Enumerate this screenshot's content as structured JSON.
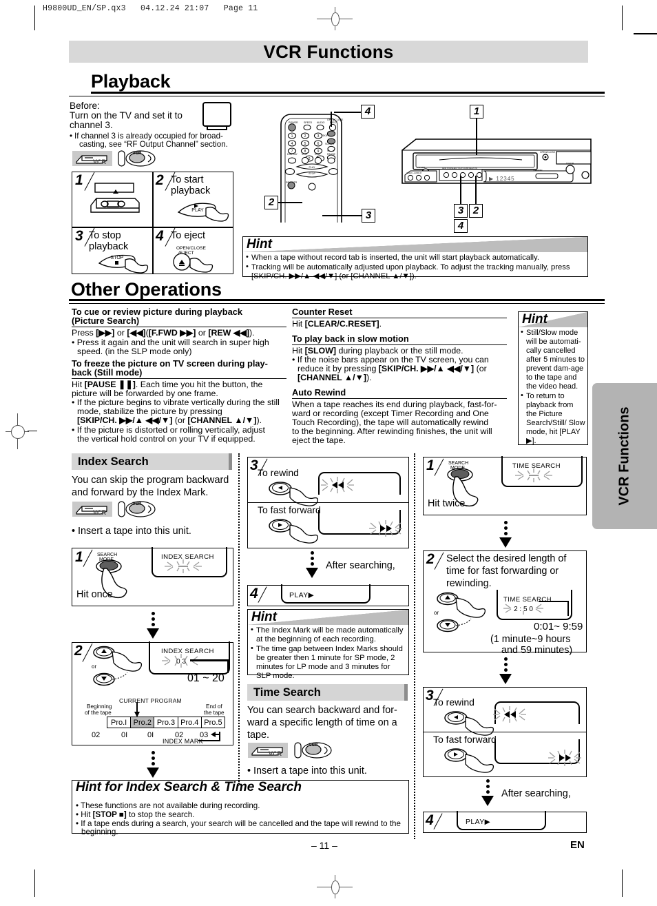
{
  "printer_slug": "H9800UD_EN/SP.qx3   04.12.24 21:07   Page 11",
  "banner_title": "VCR Functions",
  "page_number": "– 11 –",
  "language_code": "EN",
  "side_tab": "VCR Functions",
  "playback": {
    "heading": "Playback",
    "before_label": "Before:",
    "before_line1": "Turn on the TV and set it to",
    "before_line2": "channel 3.",
    "before_note_1": "If channel 3 is already occupied for broad-",
    "before_note_2": "casting, see “RF Output Channel” section.",
    "device_badges": [
      "VCR-tape-icon",
      "vcr-remote-icon"
    ],
    "steps": [
      {
        "num": "1",
        "label": "",
        "icon": "insert-tape-icon"
      },
      {
        "num": "2",
        "label_line1": "To start",
        "label_line2": "playback",
        "button": "PLAY",
        "icon": "play-button-hand-icon"
      },
      {
        "num": "3",
        "label_line1": "To stop",
        "label_line2": "playback",
        "button": "STOP",
        "icon": "stop-button-hand-icon"
      },
      {
        "num": "4",
        "label_line1": "To eject",
        "label_line2": "",
        "button_line1": "OPEN/CLOSE",
        "button_line2": "/EJECT",
        "icon": "eject-button-hand-icon"
      }
    ],
    "remote_callouts": [
      "4",
      "2",
      "3"
    ],
    "vcr_callouts": [
      "1",
      "3",
      "2",
      "4"
    ],
    "vcr_display_text": "12345",
    "remote_labels": [
      "POWER",
      "SPEED",
      "AUDIO",
      "OPEN/CLOSE",
      "EJECT",
      "SKIP/CH.",
      "SCR/TR",
      "SLOW",
      "DISPLAY",
      "VCR",
      "DVD",
      "PAUSE",
      "PLAY",
      "STOP",
      "REC/OTR"
    ],
    "hint": {
      "title": "Hint",
      "bullets": [
        "When a tape without record tab is inserted, the unit will start playback automatically.",
        "Tracking will be automatically adjusted upon playback. To adjust the tracking manually, press [SKIP/CH. ▶▶/▲ ◀◀/▼] (or [CHANNEL ▲/▼])."
      ]
    }
  },
  "other_operations": {
    "heading": "Other Operations",
    "left_column": [
      {
        "type": "h",
        "text": "To cue or review picture during playback (Picture Search)"
      },
      {
        "type": "p",
        "text": "Press [▶▶] or [◀◀]([F.FWD ▶▶] or [REW ◀◀])."
      },
      {
        "type": "b",
        "text": "Press it again and the unit will search in super high speed. (in the SLP mode only)"
      },
      {
        "type": "h",
        "text": "To freeze the picture on TV screen during play-back (Still mode)"
      },
      {
        "type": "p",
        "text": "Hit [PAUSE ❘❘]. Each time you hit the button, the picture will be forwarded by one frame."
      },
      {
        "type": "b",
        "text": "If the picture begins to vibrate vertically during the still mode, stabilize the picture by pressing [SKIP/CH. ▶▶/▲ ◀◀/▼] (or [CHANNEL ▲/▼])."
      },
      {
        "type": "b",
        "text": "If the picture is distorted or rolling vertically, adjust the vertical hold control on your TV if equipped."
      }
    ],
    "middle_column": [
      {
        "type": "h",
        "text": "Counter Reset"
      },
      {
        "type": "p",
        "text": "Hit [CLEAR/C.RESET]."
      },
      {
        "type": "h",
        "text": "To play back in slow motion"
      },
      {
        "type": "p",
        "text": "Hit [SLOW] during playback or the still mode."
      },
      {
        "type": "b",
        "text": "If the noise bars appear on the TV screen, you can reduce it by pressing [SKIP/CH. ▶▶/▲ ◀◀/▼] (or [CHANNEL ▲/▼])."
      },
      {
        "type": "h",
        "text": "Auto Rewind"
      },
      {
        "type": "p",
        "text": "When a tape reaches its end during playback, fast-forward or recording (except Timer Recording and One Touch Recording), the tape will automatically rewind to the beginning. After rewinding finishes, the unit will eject the tape."
      }
    ],
    "hint": {
      "title": "Hint",
      "bullets": [
        "Still/Slow mode will be automati-cally cancelled after 5 minutes to prevent dam-age to the tape and the video head.",
        "To return to playback from the Picture Search/Still/ Slow mode, hit [PLAY ▶]."
      ]
    }
  },
  "index_search": {
    "title": "Index Search",
    "intro_line1": "You can skip the program backward",
    "intro_line2": "and forward by the Index Mark.",
    "insert_note": "Insert a tape into this unit.",
    "step1": {
      "num": "1",
      "button_line1": "SEARCH",
      "button_line2": "MODE",
      "osd": "INDEX SEARCH",
      "caption": "Hit once."
    },
    "step2": {
      "num": "2",
      "or": "or",
      "osd": "INDEX SEARCH",
      "osd_value": "0 3",
      "range": "01 ~ 20",
      "current_program": "CURRENT PROGRAM",
      "beginning_line1": "Beginning",
      "beginning_line2": "of the tape",
      "end_line1": "End of",
      "end_line2": "the tape",
      "programs": [
        "Pro.I",
        "Pro.2",
        "Pro.3",
        "Pro.4",
        "Pro.5"
      ],
      "active_program_index": 1,
      "marks": [
        "02",
        "0I",
        "0I",
        "02",
        "03"
      ],
      "index_mark_label": "INDEX MARK"
    },
    "step3": {
      "num": "3",
      "rewind_label": "To rewind",
      "ff_label": "To fast forward",
      "rew_glyph": "◀◀",
      "ff_glyph": "▶▶"
    },
    "after_searching": "After searching,",
    "step4": {
      "num": "4",
      "osd": "PLAY▶"
    },
    "hint": {
      "title": "Hint",
      "bullets": [
        "The Index Mark will be made automatically at the beginning of each recording.",
        "The time gap between Index Marks should be greater then 1 minute for SP mode, 2 minutes for LP mode and 3 minutes for SLP mode."
      ]
    }
  },
  "time_search": {
    "title": "Time Search",
    "intro_line1": "You can search backward and for-",
    "intro_line2": "ward a specific length of time on a",
    "intro_line3": "tape.",
    "insert_note": "Insert a tape into this unit.",
    "step1": {
      "num": "1",
      "button_line1": "SEARCH",
      "button_line2": "MODE",
      "osd": "TIME SEARCH",
      "caption": "Hit twice."
    },
    "step2": {
      "num": "2",
      "line1": "Select the desired length of",
      "line2": "time for fast forwarding or",
      "line3": "rewinding.",
      "or": "or",
      "osd": "TIME SEARCH",
      "osd_value": "2 : 5 0",
      "range": "0:01~ 9:59",
      "range_note_line1": "(1 minute~9 hours",
      "range_note_line2": "and 59 minutes)"
    },
    "step3": {
      "num": "3",
      "rewind_label": "To rewind",
      "ff_label": "To fast forward",
      "rew_glyph": "◀◀",
      "ff_glyph": "▶▶"
    },
    "after_searching": "After searching,",
    "step4": {
      "num": "4",
      "osd": "PLAY▶"
    }
  },
  "bottom_hint": {
    "title": "Hint for Index Search & Time Search",
    "bullets": [
      "These functions are not available during recording.",
      "Hit [STOP ■] to stop the search.",
      "If a tape ends during a search, your search will be cancelled and the tape will rewind to the beginning."
    ]
  }
}
